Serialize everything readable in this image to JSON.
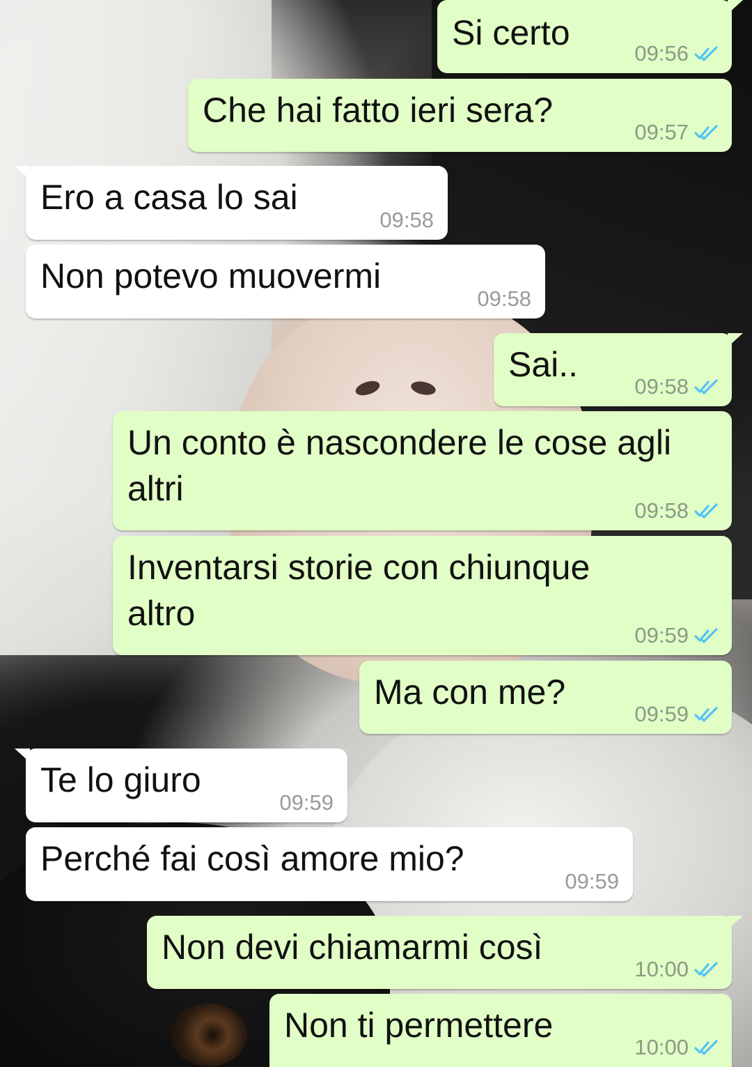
{
  "conversation": {
    "messages": [
      {
        "direction": "out",
        "text": "Si certo",
        "time": "09:56",
        "status": "read"
      },
      {
        "direction": "out",
        "text": "Che hai fatto ieri sera?",
        "time": "09:57",
        "status": "read"
      },
      {
        "direction": "in",
        "text": "Ero a casa lo sai",
        "time": "09:58"
      },
      {
        "direction": "in",
        "text": "Non potevo muovermi",
        "time": "09:58"
      },
      {
        "direction": "out",
        "text": "Sai..",
        "time": "09:58",
        "status": "read"
      },
      {
        "direction": "out",
        "text": "Un conto è nascondere le cose agli altri",
        "time": "09:58",
        "status": "read"
      },
      {
        "direction": "out",
        "text": "Inventarsi storie con chiunque altro",
        "time": "09:59",
        "status": "read"
      },
      {
        "direction": "out",
        "text": "Ma con me?",
        "time": "09:59",
        "status": "read"
      },
      {
        "direction": "in",
        "text": "Te lo giuro",
        "time": "09:59"
      },
      {
        "direction": "in",
        "text": "Perché fai così amore mio?",
        "time": "09:59"
      },
      {
        "direction": "out",
        "text": "Non devi chiamarmi così",
        "time": "10:00",
        "status": "read"
      },
      {
        "direction": "out",
        "text": "Non ti permettere",
        "time": "10:00",
        "status": "read"
      }
    ]
  },
  "colors": {
    "outgoing_bubble": "#e1fec6",
    "incoming_bubble": "#ffffff",
    "read_tick": "#4fc3f7"
  },
  "icons": {
    "read_receipt": "double-check-icon"
  }
}
